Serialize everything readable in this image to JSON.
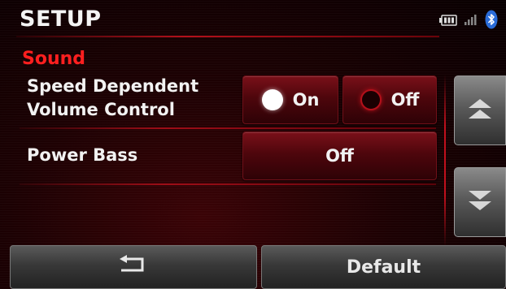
{
  "header": {
    "title": "SETUP",
    "status_icons": [
      "battery-icon",
      "signal-icon",
      "bluetooth-icon"
    ]
  },
  "section": {
    "title": "Sound"
  },
  "settings": [
    {
      "label_line1": "Speed Dependent",
      "label_line2": "Volume Control",
      "options": [
        {
          "label": "On",
          "selected": true
        },
        {
          "label": "Off",
          "selected": false
        }
      ]
    },
    {
      "label": "Power Bass",
      "value": "Off"
    }
  ],
  "scroll": {
    "up_icon": "double-chevron-up-icon",
    "down_icon": "double-chevron-down-icon"
  },
  "footer": {
    "back_icon": "back-arrow-icon",
    "default_label": "Default"
  },
  "colors": {
    "accent": "#ff1f1f",
    "background": "#1c0103",
    "button": "#5a0810"
  }
}
